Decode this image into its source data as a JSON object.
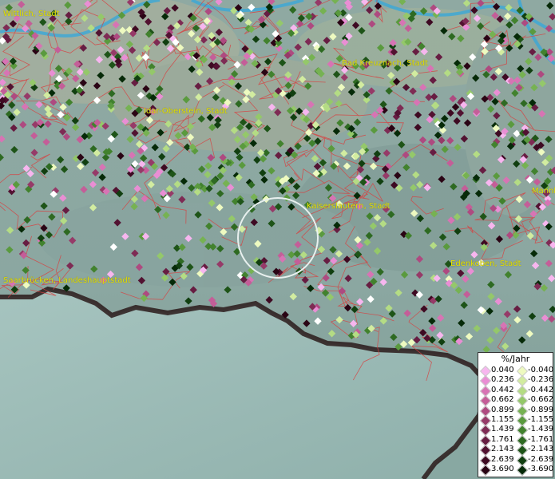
{
  "map": {
    "cities": [
      {
        "id": "wittlich",
        "label": "Wittlich, Stadt"
      },
      {
        "id": "bad-kreuznach",
        "label": "Bad Kreuznach, Stadt"
      },
      {
        "id": "idar-oberstein",
        "label": "Idar-Oberstein, Stadt"
      },
      {
        "id": "kaiserslautern",
        "label": "Kaiserslautern, Stadt"
      },
      {
        "id": "mannheim",
        "label": "Mannh"
      },
      {
        "id": "edenkoben",
        "label": "Edenkoben, Stadt"
      },
      {
        "id": "saarbruecken",
        "label": "Saarbrücken, Landeshauptstadt"
      }
    ],
    "label_color": "#e5e500",
    "boundary_color": "#e03030",
    "border_color": "#1a1010"
  },
  "legend": {
    "title": "%/Jahr",
    "positive": [
      {
        "value": "0.040",
        "color": "#f7b6ef"
      },
      {
        "value": "0.236",
        "color": "#e98ed4"
      },
      {
        "value": "0.442",
        "color": "#d774b4"
      },
      {
        "value": "0.662",
        "color": "#c45e98"
      },
      {
        "value": "0.899",
        "color": "#ae4a80"
      },
      {
        "value": "1.155",
        "color": "#963a68"
      },
      {
        "value": "1.439",
        "color": "#7e2b54"
      },
      {
        "value": "1.761",
        "color": "#671d42"
      },
      {
        "value": "2.143",
        "color": "#521231"
      },
      {
        "value": "2.639",
        "color": "#3e0a22"
      },
      {
        "value": "3.690",
        "color": "#2a0414"
      }
    ],
    "negative": [
      {
        "value": "-0.040",
        "color": "#eefac0"
      },
      {
        "value": "-0.236",
        "color": "#d2eca0"
      },
      {
        "value": "-0.442",
        "color": "#b4dc84"
      },
      {
        "value": "-0.662",
        "color": "#94c86a"
      },
      {
        "value": "-0.899",
        "color": "#76b252"
      },
      {
        "value": "-1.155",
        "color": "#5a9a3e"
      },
      {
        "value": "-1.439",
        "color": "#42822e"
      },
      {
        "value": "-1.761",
        "color": "#2e6a22"
      },
      {
        "value": "-2.143",
        "color": "#1e5418"
      },
      {
        "value": "-2.639",
        "color": "#113f10"
      },
      {
        "value": "-3.690",
        "color": "#062a08"
      }
    ]
  }
}
